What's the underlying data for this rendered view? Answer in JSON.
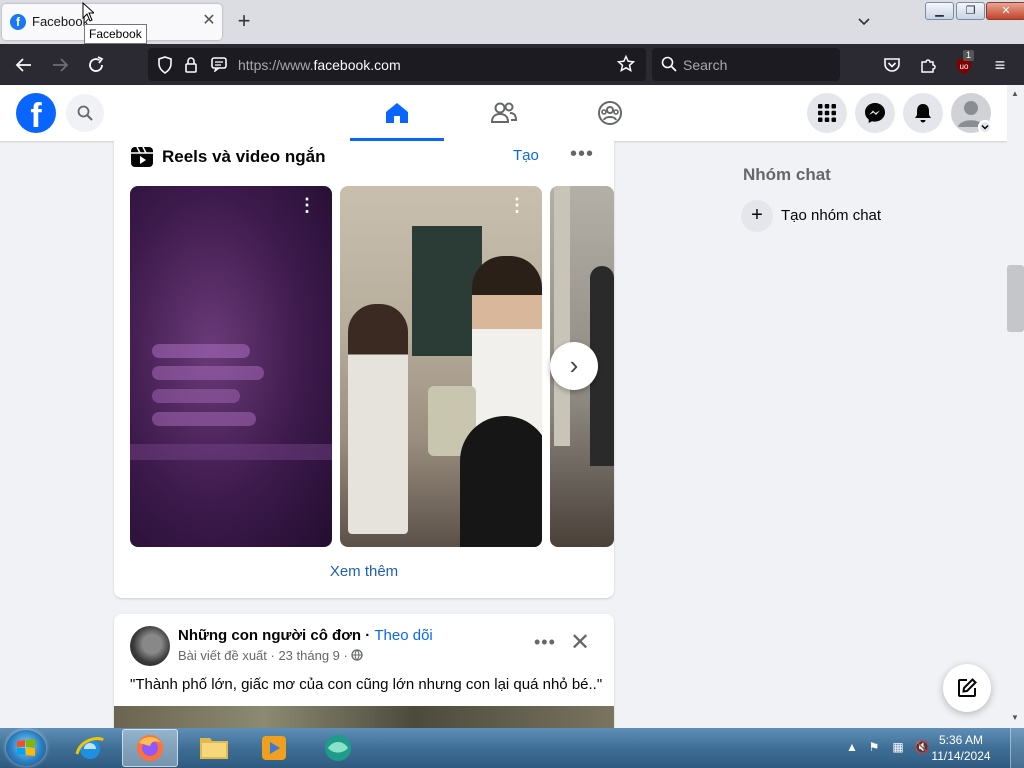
{
  "browser": {
    "tab_title": "Facebook",
    "tab_favicon": "f",
    "tooltip": "Facebook",
    "new_tab": "+",
    "url_scheme": "https://www.",
    "url_domain": "facebook.com",
    "search_placeholder": "Search",
    "extension_badge": "1"
  },
  "facebook": {
    "logo": "f",
    "reels": {
      "title": "Reels và video ngắn",
      "create": "Tạo",
      "more": "•••",
      "see_more": "Xem thêm",
      "next": "›"
    },
    "post": {
      "author": "Những con người cô đơn",
      "separator": " · ",
      "follow": "Theo dõi",
      "meta": "Bài viết đề xuất · 23 tháng 9 · ",
      "text": "\"Thành phố lớn, giấc mơ của con cũng lớn nhưng con lại quá nhỏ bé..\"",
      "more": "•••",
      "close": "✕"
    },
    "sidebar": {
      "group_chat_title": "Nhóm chat",
      "create_group": "Tạo nhóm chat",
      "plus": "+"
    },
    "colors": {
      "brand": "#0866ff",
      "link": "#1f5fba"
    }
  },
  "taskbar": {
    "time": "5:36 AM",
    "date": "11/14/2024"
  }
}
